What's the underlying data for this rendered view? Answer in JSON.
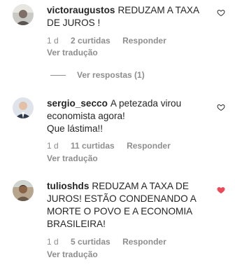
{
  "comments": [
    {
      "username": "victoraugustos",
      "text": "REDUZAM A TAXA DE JUROS !",
      "time": "1 d",
      "likes": "2 curtidas",
      "reply_label": "Responder",
      "translate_label": "Ver tradução",
      "liked": false
    },
    {
      "username": "sergio_secco",
      "text": "A petezada virou economista agora!\nQue lástima!!",
      "time": "1 d",
      "likes": "11 curtidas",
      "reply_label": "Responder",
      "translate_label": "Ver tradução",
      "liked": false
    },
    {
      "username": "tulioshds",
      "text": "REDUZAM A TAXA DE JUROS! ESTÃO CONDENANDO A MORTE O POVO E A ECONOMIA BRASILEIRA!",
      "time": "1 d",
      "likes": "5 curtidas",
      "reply_label": "Responder",
      "translate_label": "Ver tradução",
      "liked": true
    }
  ],
  "view_replies_label": "Ver respostas (1)",
  "colors": {
    "heart_liked": "#ed4956",
    "muted": "#8e8e8e",
    "text": "#262626"
  },
  "icons": {
    "like": "heart-icon"
  }
}
